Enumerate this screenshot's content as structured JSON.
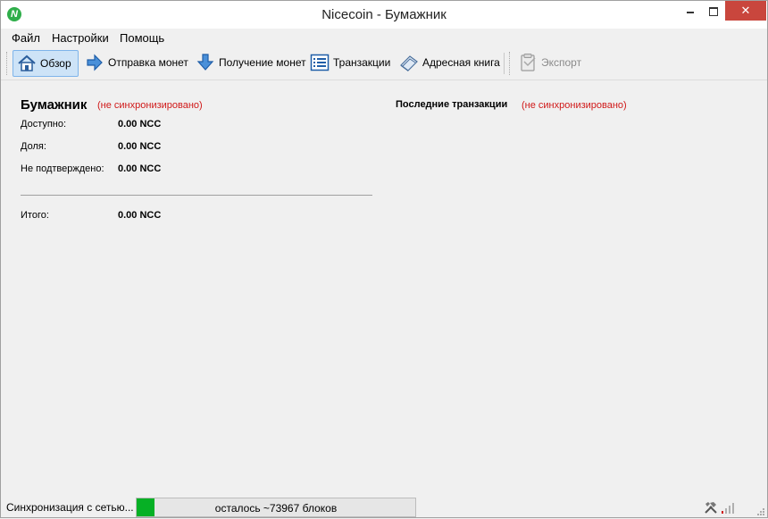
{
  "window": {
    "title": "Nicecoin - Бумажник",
    "app_icon_letter": "N",
    "close_glyph": "✕"
  },
  "menu": {
    "items": [
      "Файл",
      "Настройки",
      "Помощь"
    ]
  },
  "toolbar": {
    "items": [
      {
        "label": "Обзор",
        "icon": "home-icon",
        "active": true
      },
      {
        "label": "Отправка монет",
        "icon": "send-arrow-icon"
      },
      {
        "label": "Получение монет",
        "icon": "receive-arrow-icon"
      },
      {
        "label": "Транзакции",
        "icon": "list-icon"
      },
      {
        "label": "Адресная книга",
        "icon": "address-book-icon"
      },
      {
        "label": "Экспорт",
        "icon": "clipboard-icon",
        "disabled": true
      }
    ]
  },
  "wallet": {
    "heading": "Бумажник",
    "status": "(не синхронизировано)",
    "rows": [
      {
        "label": "Доступно:",
        "value": "0.00 NCC"
      },
      {
        "label": "Доля:",
        "value": "0.00 NCC"
      },
      {
        "label": "Не подтверждено:",
        "value": "0.00 NCC"
      }
    ],
    "total": {
      "label": "Итого:",
      "value": "0.00 NCC"
    }
  },
  "recent": {
    "title": "Последние транзакции",
    "status": "(не синхронизировано)"
  },
  "statusbar": {
    "sync_text": "Синхронизация с сетью...",
    "progress_text": "осталось ~73967 блоков",
    "progress_fraction": 0.065,
    "icons": [
      "hammer-icon",
      "signal-icon"
    ]
  },
  "colors": {
    "accent": "#06b025",
    "warning": "#d01818",
    "close": "#c9463d"
  }
}
